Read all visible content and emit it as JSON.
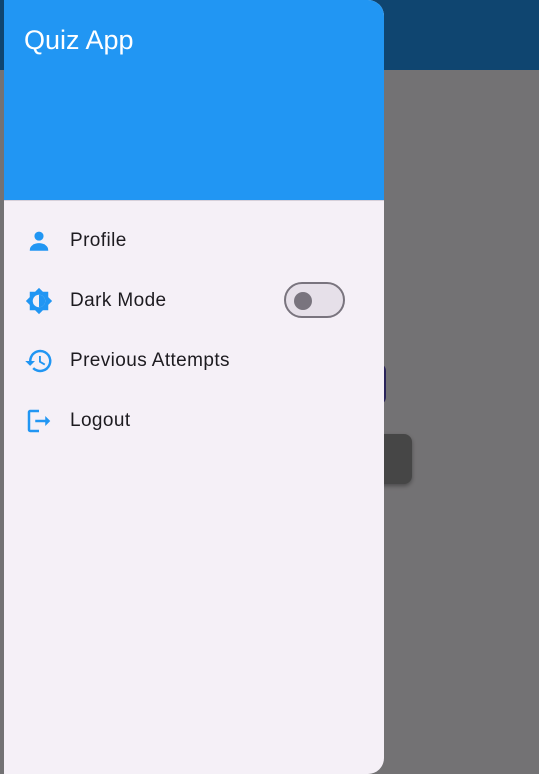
{
  "drawer": {
    "title": "Quiz App",
    "items": [
      {
        "label": "Profile",
        "icon": "person-icon"
      },
      {
        "label": "Dark Mode",
        "icon": "brightness-icon",
        "toggle": false
      },
      {
        "label": "Previous Attempts",
        "icon": "history-icon"
      },
      {
        "label": "Logout",
        "icon": "logout-icon"
      }
    ]
  },
  "colors": {
    "primary": "#2196f3",
    "drawer_bg": "#f5f0f7",
    "icon": "#2196f3",
    "text": "#1d1b20"
  }
}
